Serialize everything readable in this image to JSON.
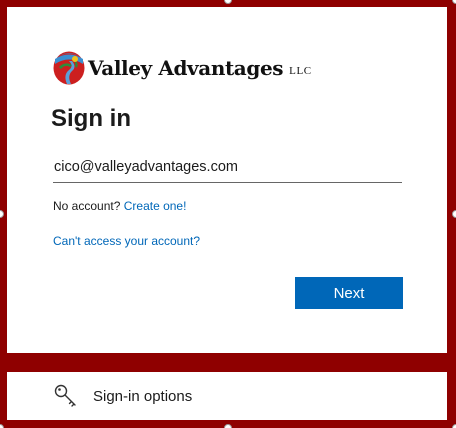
{
  "brand": {
    "name": "Valley Advantages",
    "suffix": "LLC"
  },
  "signin": {
    "title": "Sign in",
    "email_value": "cico@valleyadvantages.com",
    "no_account_text": "No account?",
    "create_link": "Create one!",
    "cant_access_link": "Can't access your account?",
    "next_label": "Next"
  },
  "options": {
    "label": "Sign-in options",
    "icon": "key-icon"
  },
  "colors": {
    "frame": "#8f0000",
    "accent": "#0067b8",
    "link": "#0067b8"
  }
}
